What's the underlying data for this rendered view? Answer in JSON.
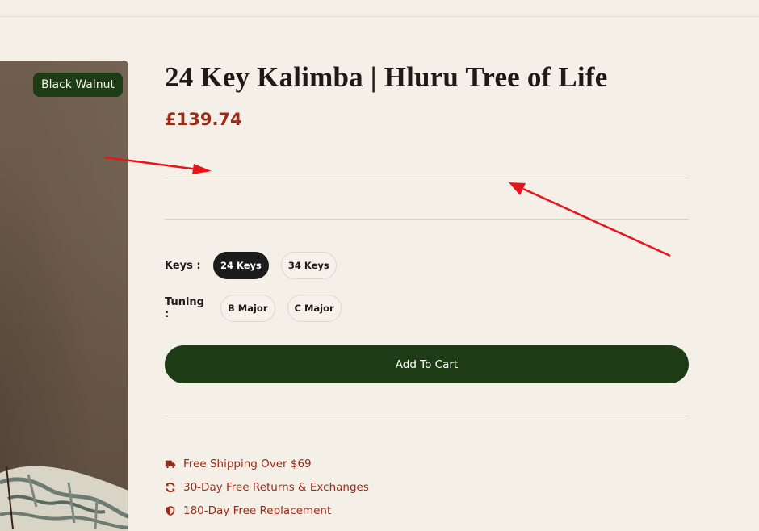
{
  "product": {
    "badge": "Black Walnut",
    "title": "24 Key Kalimba | Hluru Tree of Life",
    "price": "£139.74"
  },
  "options": {
    "keys": {
      "label": "Keys :",
      "values": [
        "24 Keys",
        "34 Keys"
      ],
      "selected": "24 Keys"
    },
    "tuning": {
      "label": "Tuning :",
      "values": [
        "B Major",
        "C Major"
      ]
    }
  },
  "cart": {
    "add_label": "Add To Cart"
  },
  "perks": [
    {
      "icon": "truck-icon",
      "text": "Free Shipping Over $69"
    },
    {
      "icon": "refresh-icon",
      "text": "30-Day Free Returns & Exchanges"
    },
    {
      "icon": "shield-icon",
      "text": "180-Day Free Replacement"
    }
  ],
  "colors": {
    "accent_green": "#1d3b14",
    "price_red": "#9a2b18",
    "background": "#f4efe7",
    "annotation_red": "#e8141a"
  }
}
